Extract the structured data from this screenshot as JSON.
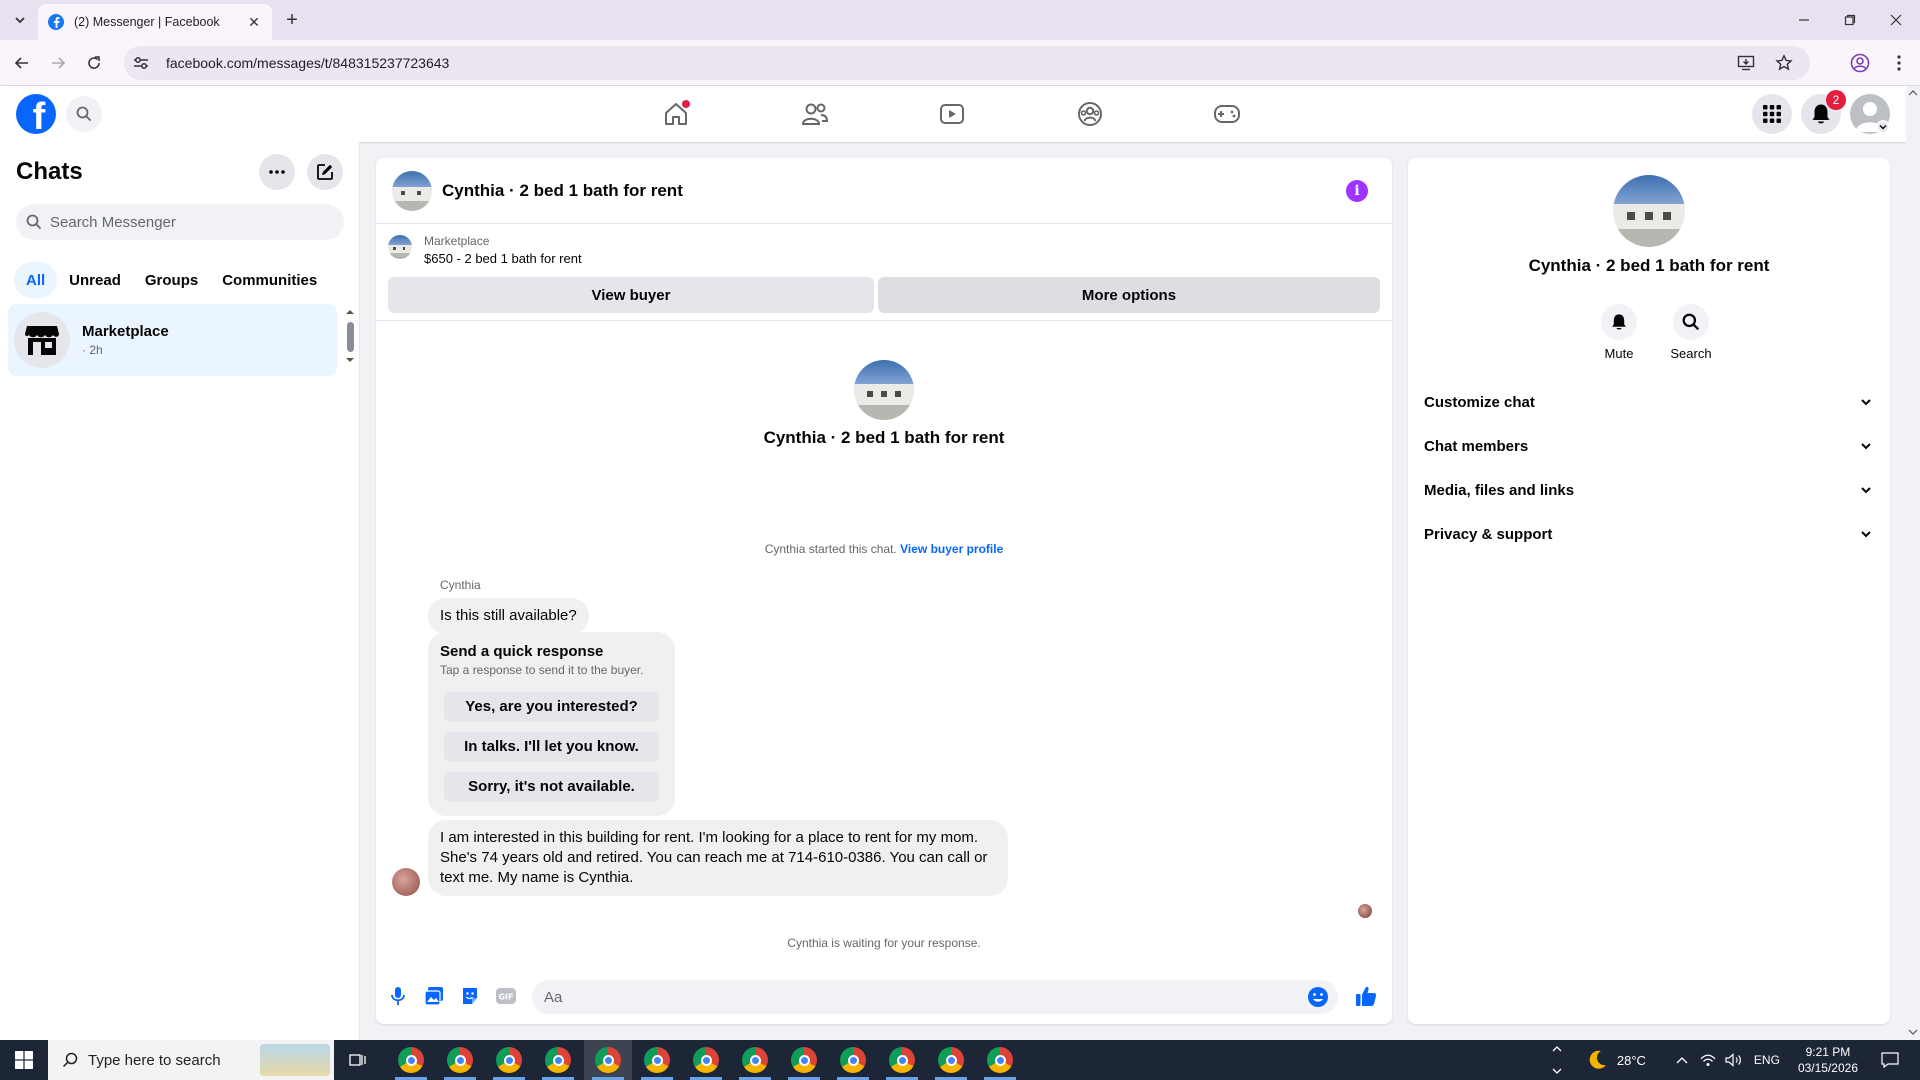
{
  "browser": {
    "tab_title": "(2) Messenger | Facebook",
    "url": "facebook.com/messages/t/848315237723643"
  },
  "fb_nav": {
    "notification_count": "2"
  },
  "left_panel": {
    "title": "Chats",
    "search_placeholder": "Search Messenger",
    "filters": [
      "All",
      "Unread",
      "Groups",
      "Communities"
    ],
    "active_filter": "All",
    "chats": [
      {
        "name": "Marketplace",
        "time": "· 2h"
      }
    ]
  },
  "conversation": {
    "title": "Cynthia · 2 bed 1 bath for rent",
    "marketplace_label": "Marketplace",
    "listing": "$650 - 2 bed 1 bath for rent",
    "view_buyer_label": "View buyer",
    "more_options_label": "More options",
    "intro_name": "Cynthia · 2 bed 1 bath for rent",
    "started_text": "Cynthia started this chat.",
    "view_buyer_profile": "View buyer profile",
    "sender_name": "Cynthia",
    "message_1": "Is this still available?",
    "quick_title": "Send a quick response",
    "quick_subtitle": "Tap a response to send it to the buyer.",
    "quick_responses": [
      "Yes, are you interested?",
      "In talks. I'll let you know.",
      "Sorry, it's not available."
    ],
    "message_2": "I am interested in this building for rent. I'm looking for a place to rent for my mom. She's 74 years old and retired. You can reach me at 714-610-0386. You can call or text me. My name is Cynthia.",
    "waiting_text": "Cynthia is waiting for your response.",
    "composer_placeholder": "Aa"
  },
  "info_panel": {
    "name": "Cynthia · 2 bed 1 bath for rent",
    "mute_label": "Mute",
    "search_label": "Search",
    "sections": [
      "Customize chat",
      "Chat members",
      "Media, files and links",
      "Privacy & support"
    ]
  },
  "taskbar": {
    "search_placeholder": "Type here to search",
    "temperature": "28°C",
    "language": "ENG",
    "time": "9:21 PM",
    "date": "03/15/2026"
  },
  "colors": {
    "facebook_blue": "#0866ff",
    "selection_bg": "#ebf5ff",
    "info_purple": "#a033ff",
    "badge_red": "#e41e3f"
  }
}
